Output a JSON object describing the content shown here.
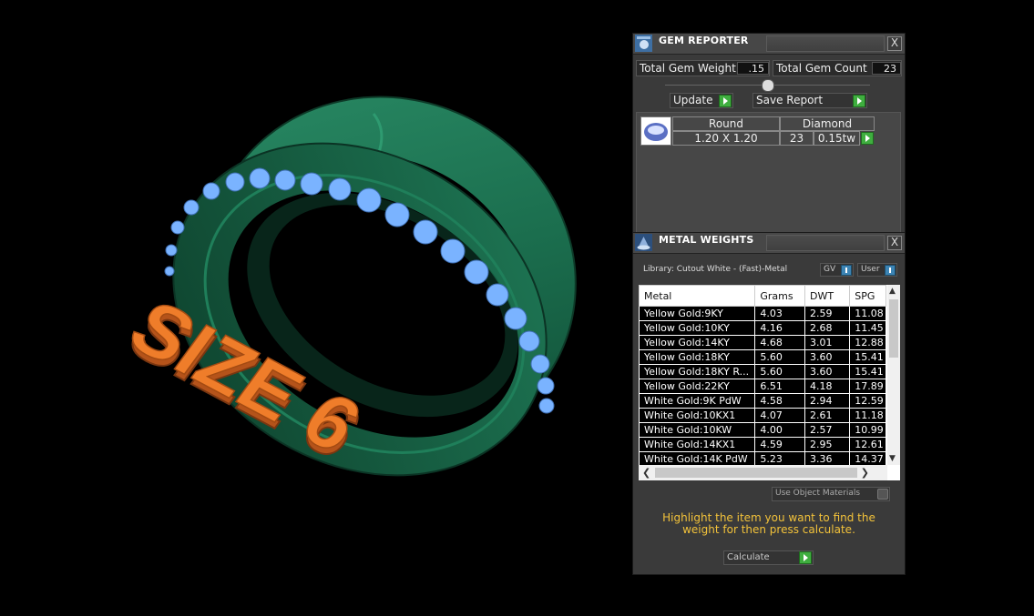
{
  "scene": {
    "engraving_text": "SIZE 6",
    "colors": {
      "ring": "#1e7a56",
      "ring_dark": "#0f4a33",
      "gems": "#7ab3ff",
      "engraving": "#ef7d2a"
    }
  },
  "gem_reporter": {
    "title": "GEM REPORTER",
    "close_label": "X",
    "total_weight_label": "Total Gem Weight",
    "total_weight_value": ".15",
    "total_count_label": "Total Gem Count",
    "total_count_value": "23",
    "update_label": "Update",
    "save_report_label": "Save Report",
    "gem_row": {
      "shape": "Round",
      "material": "Diamond",
      "size": "1.20 X 1.20",
      "count": "23",
      "carat": "0.15tw"
    }
  },
  "metal_weights": {
    "title": "METAL WEIGHTS",
    "close_label": "X",
    "library_label": "Library: Cutout White - (Fast)-Metal",
    "gv_label": "GV",
    "user_label": "User",
    "columns": [
      "Metal",
      "Grams",
      "DWT",
      "SPG"
    ],
    "rows": [
      [
        "Yellow Gold:9KY",
        "4.03",
        "2.59",
        "11.08"
      ],
      [
        "Yellow Gold:10KY",
        "4.16",
        "2.68",
        "11.45"
      ],
      [
        "Yellow Gold:14KY",
        "4.68",
        "3.01",
        "12.88"
      ],
      [
        "Yellow Gold:18KY",
        "5.60",
        "3.60",
        "15.41"
      ],
      [
        "Yellow Gold:18KY R...",
        "5.60",
        "3.60",
        "15.41"
      ],
      [
        "Yellow Gold:22KY",
        "6.51",
        "4.18",
        "17.89"
      ],
      [
        "White Gold:9K PdW",
        "4.58",
        "2.94",
        "12.59"
      ],
      [
        "White Gold:10KX1",
        "4.07",
        "2.61",
        "11.18"
      ],
      [
        "White Gold:10KW",
        "4.00",
        "2.57",
        "10.99"
      ],
      [
        "White Gold:14KX1",
        "4.59",
        "2.95",
        "12.61"
      ],
      [
        "White Gold:14K PdW",
        "5.23",
        "3.36",
        "14.37"
      ]
    ],
    "use_object_materials_label": "Use Object Materials",
    "instruction": "Highlight the item you want to find the weight for then press calculate.",
    "calculate_label": "Calculate"
  }
}
